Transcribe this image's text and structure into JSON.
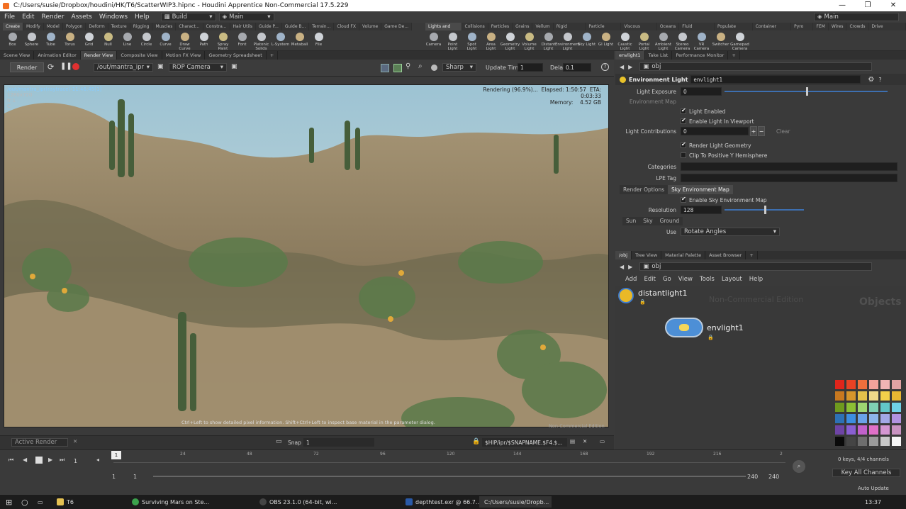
{
  "titlebar": {
    "title": "C:/Users/susie/Dropbox/houdini/HK/T6/ScatterWIP3.hipnc - Houdini Apprentice Non-Commercial 17.5.229"
  },
  "menubar": {
    "items": [
      "File",
      "Edit",
      "Render",
      "Assets",
      "Windows",
      "Help"
    ],
    "desktop": "Build",
    "main": "Main",
    "right_main": "Main"
  },
  "shelf": {
    "left_tabs": [
      "Create",
      "Modify",
      "Model",
      "Polygon",
      "Deform",
      "Texture",
      "Rigging",
      "Muscles",
      "Charact...",
      "Constra...",
      "Hair Utils",
      "Guide P...",
      "Guide B...",
      "Terrain...",
      "Cloud FX",
      "Volume",
      "Game De..."
    ],
    "left_tools": [
      "Box",
      "Sphere",
      "Tube",
      "Torus",
      "Grid",
      "Null",
      "Line",
      "Circle",
      "Curve",
      "Draw Curve",
      "Path",
      "Spray Paint",
      "Font",
      "Platonic Solids",
      "L-System",
      "Metaball",
      "File"
    ],
    "right_tabs": [
      "Lights and C...",
      "Collisions",
      "Particles",
      "Grains",
      "Vellum",
      "Rigid Bodies",
      "Particle Fluids",
      "Viscous Fluids",
      "Oceans",
      "Fluid Contai...",
      "Populate Con...",
      "Container Tools",
      "Pyro FX",
      "FEM",
      "Wires",
      "Crowds",
      "Drive Simula..."
    ],
    "right_tools": [
      "Camera",
      "Point Light",
      "Spot Light",
      "Area Light",
      "Geometry Light",
      "Volume Light",
      "Distant Light",
      "Environment Light",
      "Sky Light",
      "GI Light",
      "Caustic Light",
      "Portal Light",
      "Ambient Light",
      "Stereo Camera",
      "VR Camera",
      "Switcher",
      "Gamepad Camera"
    ]
  },
  "pane_tabs": [
    "Scene View",
    "Animation Editor",
    "Render View",
    "Composite View",
    "Motion FX View",
    "Geometry Spreadsheet"
  ],
  "render_toolbar": {
    "render_button": "Render",
    "rop_path": "/out/mantra_ipr",
    "camera": "ROP Camera",
    "sharp": "Sharp",
    "update_time_label": "Update Time",
    "update_time_value": "1",
    "delay_label": "Delay",
    "delay_value": "0.1"
  },
  "viewport": {
    "path": "/out/mantra_ipr(raytrace)-11:46:45[1]",
    "resolution": "1280x720",
    "frame": "fr 1",
    "channel": "C",
    "status": "Rendering (96.9%)...",
    "elapsed": "Elapsed: 1:50:57",
    "eta": "ETA: 0:03:33",
    "memory_label": "Memory:",
    "memory_value": "4.52 GB",
    "hint": "Ctrl+Left to show detailed pixel information. Shift+Ctrl+Left to inspect base material in the parameter dialog.",
    "watermark": "Non-Commercial Edition"
  },
  "render_bottom": {
    "active_render": "Active Render",
    "snap": "Snap",
    "snap_value": "1",
    "output_path": "$HIP/ipr/$SNAPNAME.$F4.$..."
  },
  "param_panel": {
    "tabs": [
      "envlight1",
      "Take List",
      "Performance Monitor"
    ],
    "path": "obj",
    "node_type": "Environment Light",
    "node_name": "envlight1",
    "light_exposure_label": "Light Exposure",
    "light_exposure_value": "0",
    "light_exposure_slider": 0.5,
    "environment_map_label": "Environment Map",
    "light_enabled": "Light Enabled",
    "enable_in_viewport": "Enable Light In Viewport",
    "light_contributions_label": "Light Contributions",
    "light_contributions_value": "0",
    "clear": "Clear",
    "render_light_geometry": "Render Light Geometry",
    "clip_hemisphere": "Clip To Positive Y Hemisphere",
    "categories_label": "Categories",
    "lpe_tag_label": "LPE Tag",
    "subtabs": [
      "Render Options",
      "Sky Environment Map"
    ],
    "enable_sky_map": "Enable Sky Environment Map",
    "resolution_label": "Resolution",
    "resolution_value": "128",
    "resolution_slider": 0.5,
    "sky_tabs": [
      "Sun",
      "Sky",
      "Ground"
    ],
    "use_label": "Use",
    "use_value": "Rotate Angles"
  },
  "network_panel": {
    "tabs": [
      "/obj",
      "Tree View",
      "Material Palette",
      "Asset Browser"
    ],
    "path": "obj",
    "menu": [
      "Add",
      "Edit",
      "Go",
      "View",
      "Tools",
      "Layout",
      "Help"
    ],
    "watermark": "Non-Commercial Edition",
    "context": "Objects",
    "nodes": [
      "distantlight1",
      "envlight1"
    ]
  },
  "timeline": {
    "frame": "1",
    "ticks": [
      "1",
      "24",
      "48",
      "72",
      "96",
      "120",
      "144",
      "168",
      "192",
      "216",
      "2"
    ],
    "range_start": "1",
    "range_start2": "1",
    "range_end": "240",
    "range_end2": "240",
    "keys": "0 keys, 4/4 channels",
    "key_all": "Key All Channels",
    "auto_update": "Auto Update"
  },
  "taskbar": {
    "items": [
      "T6",
      "Surviving Mars on Ste...",
      "OBS 23.1.0 (64-bit, wi...",
      "depthtest.exr @ 66.7...",
      "C:/Users/susie/Dropb..."
    ],
    "time": "13:37"
  },
  "colors": {
    "palette": [
      "#e0251b",
      "#e84224",
      "#ef6f3c",
      "#f2a29a",
      "#f0b4b4",
      "#e0a3a3",
      "#c8781f",
      "#d6952b",
      "#e3c04a",
      "#efd98a",
      "#f2d04a",
      "#e8b732",
      "#6f9a1e",
      "#8cbf34",
      "#9fd672",
      "#7fcfb4",
      "#62c6c8",
      "#6fd1e6",
      "#2d71b5",
      "#3d8ee0",
      "#6aa2e8",
      "#8db4ea",
      "#a3a8e6",
      "#b192e0",
      "#6e44a5",
      "#8a5fd2",
      "#c061cb",
      "#e070c8",
      "#d496d1",
      "#c893c1",
      "#0a0a0a",
      "#454545",
      "#6e6e6e",
      "#9a9a9a",
      "#c8c8c8",
      "#f6f6f6"
    ]
  }
}
